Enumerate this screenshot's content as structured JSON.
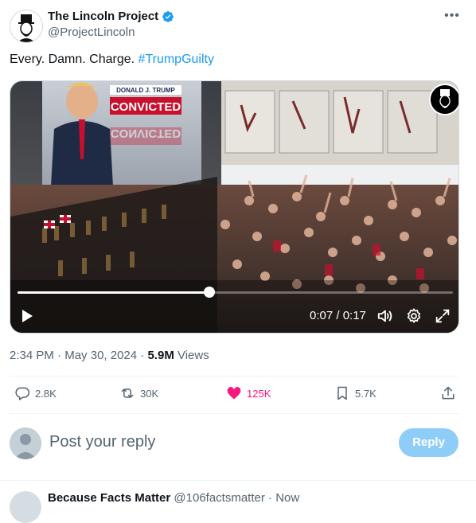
{
  "tweet": {
    "author_name": "The Lincoln Project",
    "author_handle": "@ProjectLincoln",
    "text_main": "Every. Damn. Charge.",
    "hashtag": "#TrumpGuilty",
    "more_label": "•••"
  },
  "video": {
    "banner_top": "DONALD J. TRUMP",
    "banner_main": "CONVICTED",
    "banner_reflection": "CONVICTED",
    "progress_fraction": 0.44,
    "time_display": "0:07 / 0:17",
    "icons": [
      "play-icon",
      "volume-icon",
      "settings-icon",
      "fullscreen-icon",
      "lincoln-logo-icon"
    ]
  },
  "meta": {
    "time": "2:34 PM",
    "separator": " · ",
    "date": "May 30, 2024",
    "views_count": "5.9M",
    "views_label": " Views"
  },
  "actions": {
    "replies": "2.8K",
    "reposts": "30K",
    "likes": "125K",
    "bookmarks": "5.7K"
  },
  "reply_box": {
    "placeholder": "Post your reply",
    "button_label": "Reply"
  },
  "next_reply": {
    "name": "Because Facts Matter",
    "handle": "@106factsmatter",
    "time": "· Now"
  },
  "colors": {
    "accent": "#1d9bf0",
    "like": "#f91880",
    "muted": "#536471",
    "reply_button_disabled": "#8ecdf8",
    "banner_red": "#c8102e"
  }
}
